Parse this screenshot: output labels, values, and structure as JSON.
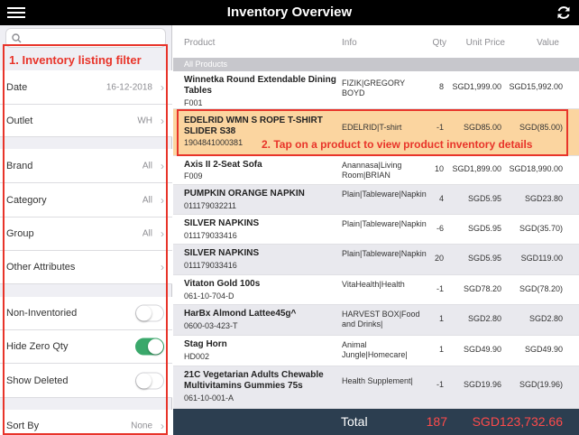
{
  "app": {
    "title": "Inventory Overview"
  },
  "icons": {
    "menu": "hamburger-menu-icon",
    "refresh": "refresh-icon",
    "search": "search-icon"
  },
  "colors": {
    "accent_red": "#e8342a",
    "highlight": "#fbd5a0",
    "footer": "#2c3e50",
    "toggle_on": "#3aa86b"
  },
  "annotations": {
    "filter": "1. Inventory listing filter",
    "row": "2. Tap on a product to view product inventory details"
  },
  "filters": {
    "date": {
      "label": "Date",
      "value": "16-12-2018"
    },
    "outlet": {
      "label": "Outlet",
      "value": "WH"
    },
    "brand": {
      "label": "Brand",
      "value": "All"
    },
    "category": {
      "label": "Category",
      "value": "All"
    },
    "group": {
      "label": "Group",
      "value": "All"
    },
    "other": {
      "label": "Other Attributes"
    },
    "non_inventoried": {
      "label": "Non-Inventoried",
      "on": false
    },
    "hide_zero": {
      "label": "Hide Zero Qty",
      "on": true
    },
    "show_deleted": {
      "label": "Show Deleted",
      "on": false
    },
    "sort_by": {
      "label": "Sort By",
      "value": "None"
    }
  },
  "table": {
    "headers": {
      "product": "Product",
      "info": "Info",
      "qty": "Qty",
      "unit_price": "Unit Price",
      "value": "Value"
    },
    "section": "All Products",
    "rows": [
      {
        "name": "Winnetka Round Extendable Dining Tables",
        "code": "F001",
        "info": "FIZIK|GREGORY BOYD",
        "qty": "8",
        "price": "SGD1,999.00",
        "value": "SGD15,992.00"
      },
      {
        "name": "EDELRID WMN S ROPE T-SHIRT SLIDER S38",
        "code": "1904841000381",
        "info": "EDELRID|T-shirt",
        "qty": "-1",
        "price": "SGD85.00",
        "value": "SGD(85.00)"
      },
      {
        "name": "Axis II 2-Seat Sofa",
        "code": "F009",
        "info": "Anannasa|Living Room|BRIAN",
        "qty": "10",
        "price": "SGD1,899.00",
        "value": "SGD18,990.00"
      },
      {
        "name": "PUMPKIN ORANGE NAPKIN",
        "code": "011179032211",
        "info": "Plain|Tableware|Napkin",
        "qty": "4",
        "price": "SGD5.95",
        "value": "SGD23.80"
      },
      {
        "name": "SILVER NAPKINS",
        "code": "011179033416",
        "info": "Plain|Tableware|Napkin",
        "qty": "-6",
        "price": "SGD5.95",
        "value": "SGD(35.70)"
      },
      {
        "name": "SILVER NAPKINS",
        "code": "011179033416",
        "info": "Plain|Tableware|Napkin",
        "qty": "20",
        "price": "SGD5.95",
        "value": "SGD119.00"
      },
      {
        "name": "Vitaton Gold 100s",
        "code": "061-10-704-D",
        "info": "VitaHealth|Health",
        "qty": "-1",
        "price": "SGD78.20",
        "value": "SGD(78.20)"
      },
      {
        "name": "HarBx Almond Lattee45g^",
        "code": "0600-03-423-T",
        "info": "HARVEST BOX|Food and Drinks|",
        "qty": "1",
        "price": "SGD2.80",
        "value": "SGD2.80"
      },
      {
        "name": "Stag Horn",
        "code": "HD002",
        "info": "Animal Jungle|Homecare|",
        "qty": "1",
        "price": "SGD49.90",
        "value": "SGD49.90"
      },
      {
        "name": "21C Vegetarian Adults Chewable Multivitamins Gummies 75s",
        "code": "061-10-001-A",
        "info": "Health Supplement|",
        "qty": "-1",
        "price": "SGD19.96",
        "value": "SGD(19.96)"
      }
    ]
  },
  "footer": {
    "label": "Total",
    "qty": "187",
    "value": "SGD123,732.66"
  }
}
